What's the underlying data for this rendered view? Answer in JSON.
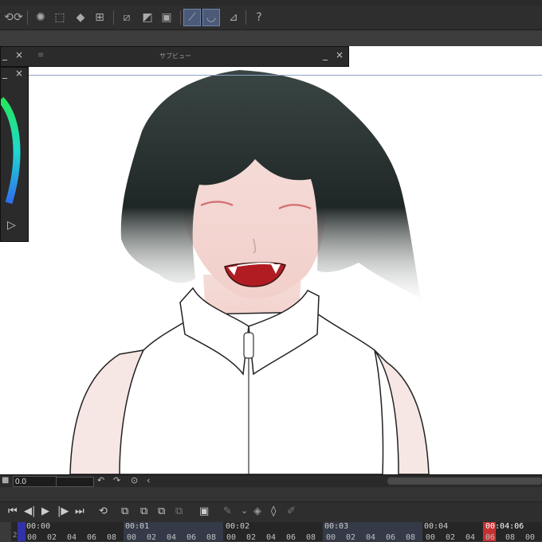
{
  "subview": {
    "title": "サブビュー",
    "minimize": "_",
    "close": "×"
  },
  "color_panel": {
    "minimize": "_",
    "close": "×",
    "close2": "×",
    "play_icon": "▷"
  },
  "timeline": {
    "frame_input": "0.0",
    "labels": [
      "00:00",
      "00:01",
      "00:02",
      "00:03",
      "00:04",
      "00:04:06"
    ],
    "ticks": [
      "00",
      "02",
      "04",
      "06",
      "08"
    ],
    "row_number": "2",
    "colors": {
      "playhead": "#c43131",
      "first_frame": "#3232a8"
    }
  },
  "toolbar": {
    "icons": [
      "undo-icon",
      "redo-icon",
      "sparkle-icon",
      "selection-icon",
      "fill-icon",
      "transform-icon",
      "crop-icon",
      "invert-icon",
      "square-icon",
      "ruler-icon",
      "brush-icon",
      "pen-icon",
      "help-icon"
    ]
  }
}
